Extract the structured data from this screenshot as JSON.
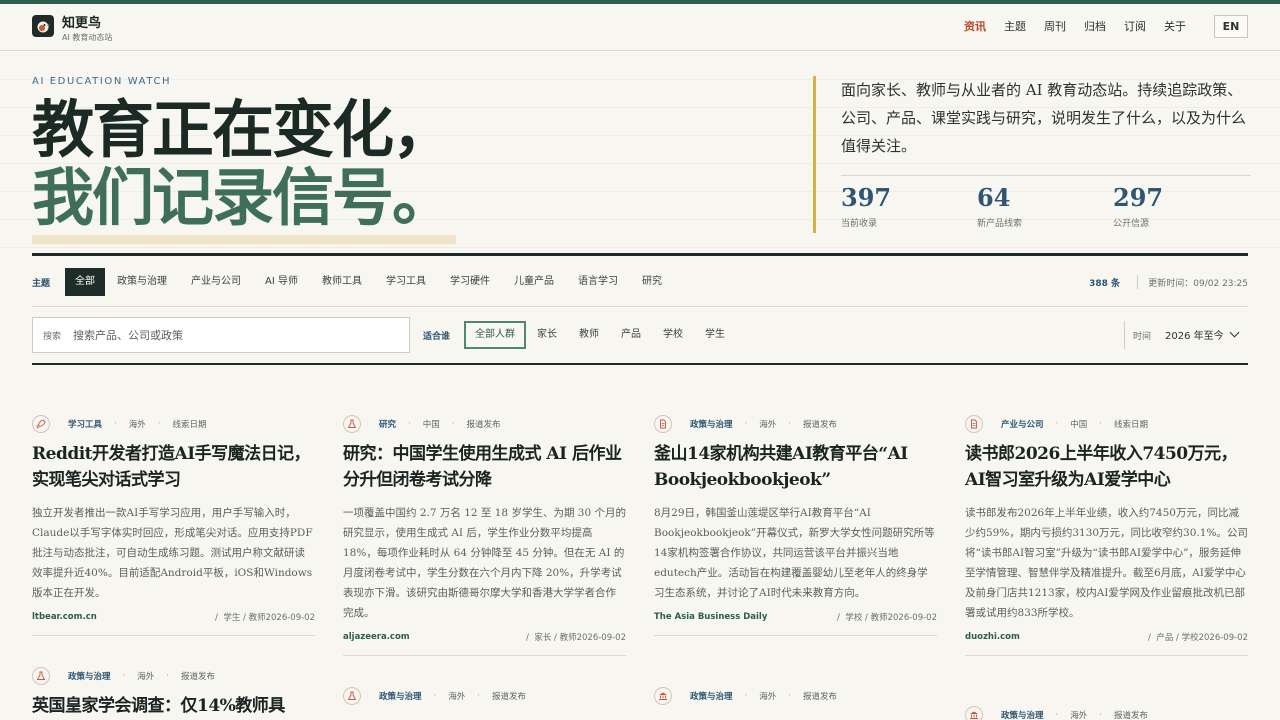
{
  "brand": {
    "name": "知更鸟",
    "subtitle": "AI 教育动态站"
  },
  "nav": {
    "items": [
      {
        "label": "资讯",
        "active": true
      },
      {
        "label": "主题"
      },
      {
        "label": "周刊"
      },
      {
        "label": "归档"
      },
      {
        "label": "订阅"
      },
      {
        "label": "关于"
      }
    ],
    "lang": "EN"
  },
  "hero": {
    "eyebrow": "AI EDUCATION WATCH",
    "line1": "教育正在变化，",
    "line2": "我们记录信号。",
    "description": "面向家长、教师与从业者的 AI 教育动态站。持续追踪政策、公司、产品、课堂实践与研究，说明发生了什么，以及为什么值得关注。",
    "stats": [
      {
        "value": "397",
        "label": "当前收录"
      },
      {
        "value": "64",
        "label": "新产品线索"
      },
      {
        "value": "297",
        "label": "公开信源"
      }
    ]
  },
  "filters": {
    "topic_label": "主题",
    "topics": [
      "全部",
      "政策与治理",
      "产业与公司",
      "AI 导师",
      "教师工具",
      "学习工具",
      "学习硬件",
      "儿童产品",
      "语言学习",
      "研究"
    ],
    "count": "388 条",
    "updated": "更新时间：09/02 23:25",
    "search_label": "搜索",
    "search_placeholder": "搜索产品、公司或政策",
    "audience_label": "适合谁",
    "audiences": [
      "全部人群",
      "家长",
      "教师",
      "产品",
      "学校",
      "学生"
    ],
    "time_label": "时间",
    "time_value": "2026 年至今"
  },
  "cards": [
    {
      "category": "学习工具",
      "region": "海外",
      "date_type": "线索日期",
      "title": "Reddit开发者打造AI手写魔法日记，实现笔尖对话式学习",
      "body": "独立开发者推出一款AI手写学习应用，用户手写输入时，Claude以手写字体实时回应，形成笔尖对话。应用支持PDF批注与动态批注，可自动生成练习题。测试用户称文献研读效率提升近40%。目前适配Android平板，iOS和Windows版本正在开发。",
      "source": "ltbear.com.cn",
      "audience": "学生 / 教师",
      "date": "2026-09-02"
    },
    {
      "category": "研究",
      "region": "中国",
      "date_type": "报道发布",
      "title": "研究：中国学生使用生成式 AI 后作业分升但闭卷考试分降",
      "body": "一项覆盖中国约 2.7 万名 12 至 18 岁学生、为期 30 个月的研究显示，使用生成式 AI 后，学生作业分数平均提高 18%，每项作业耗时从 64 分钟降至 45 分钟。但在无 AI 的月度闭卷考试中，学生分数在六个月内下降 20%，升学考试表现亦下滑。该研究由斯德哥尔摩大学和香港大学学者合作完成。",
      "source": "aljazeera.com",
      "audience": "家长 / 教师",
      "date": "2026-09-02"
    },
    {
      "category": "政策与治理",
      "region": "海外",
      "date_type": "报道发布",
      "title": "釜山14家机构共建AI教育平台“AI Bookjeokbookjeok”",
      "body": "8月29日，韩国釜山莲堤区举行AI教育平台“AI Bookjeokbookjeok”开幕仪式，新罗大学女性问题研究所等14家机构签署合作协议，共同运营该平台并振兴当地edutech产业。活动旨在构建覆盖婴幼儿至老年人的终身学习生态系统，并讨论了AI时代未来教育方向。",
      "source": "The Asia Business Daily",
      "audience": "学校 / 教师",
      "date": "2026-09-02"
    },
    {
      "category": "产业与公司",
      "region": "中国",
      "date_type": "线索日期",
      "title": "读书郎2026上半年收入7450万元，AI智习室升级为AI爱学中心",
      "body": "读书郎发布2026年上半年业绩，收入约7450万元，同比减少约59%，期内亏损约3130万元，同比收窄约30.1%。公司将“读书郎AI智习室”升级为“读书郎AI爱学中心”，服务延伸至学情管理、智慧伴学及精准提升。截至6月底，AI爱学中心及前身门店共1213家，校内AI爱学网及作业留痕批改机已部署或试用约833所学校。",
      "source": "duozhi.com",
      "audience": "产品 / 学校",
      "date": "2026-09-02"
    },
    {
      "category": "政策与治理",
      "region": "海外",
      "date_type": "报道发布",
      "title": "英国皇家学会调查：仅14%教师具",
      "body": "",
      "source": "",
      "audience": "",
      "date": ""
    },
    {
      "category": "政策与治理",
      "region": "海外",
      "date_type": "报道发布",
      "title": "",
      "body": "",
      "source": "",
      "audience": "",
      "date": ""
    },
    {
      "category": "政策与治理",
      "region": "海外",
      "date_type": "报道发布",
      "title": "",
      "body": "",
      "source": "",
      "audience": "",
      "date": ""
    },
    {
      "category": "政策与治理",
      "region": "海外",
      "date_type": "报道发布",
      "title": "",
      "body": "",
      "source": "",
      "audience": "",
      "date": ""
    }
  ]
}
